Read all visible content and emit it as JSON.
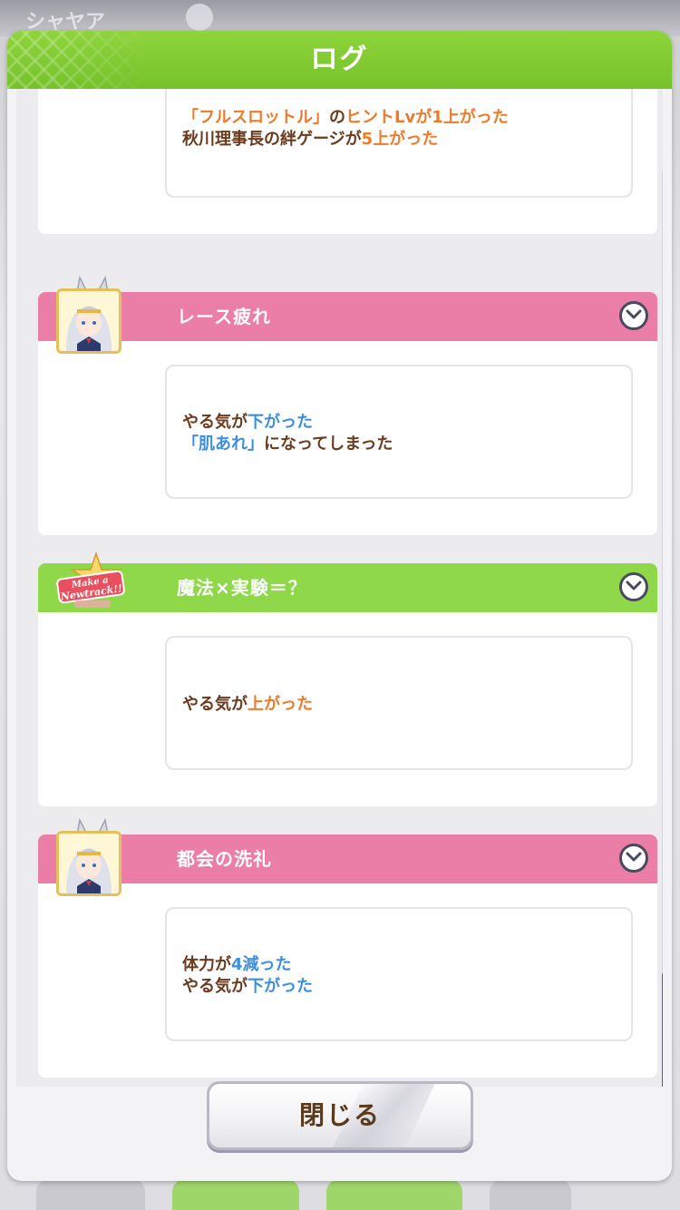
{
  "background": {
    "top_text": "シャヤア"
  },
  "modal": {
    "title": "ログ",
    "close_label": "閉じる"
  },
  "entries": [
    {
      "title": "",
      "lines": [
        [
          {
            "text": "「フルスロットル」",
            "tone": "orange"
          },
          {
            "text": "の",
            "tone": "brown"
          },
          {
            "text": "ヒントLvが1上がった",
            "tone": "orange"
          }
        ],
        [
          {
            "text": "秋川理事長の絆ゲージが",
            "tone": "brown"
          },
          {
            "text": "5上がった",
            "tone": "orange"
          }
        ]
      ]
    },
    {
      "title": "レース疲れ",
      "header_color": "#ea7ea6",
      "icon": "character-portrait",
      "lines": [
        [
          {
            "text": "やる気が",
            "tone": "brown"
          },
          {
            "text": "下がった",
            "tone": "blue"
          }
        ],
        [
          {
            "text": "「肌あれ」",
            "tone": "blue"
          },
          {
            "text": "になってしまった",
            "tone": "brown"
          }
        ]
      ]
    },
    {
      "title": "魔法×実験＝？",
      "header_color": "#8ed84a",
      "icon": "make-a-new-track-badge",
      "badge_text": [
        "Make a",
        "Newtrack!!"
      ],
      "lines": [
        [
          {
            "text": "やる気が",
            "tone": "brown"
          },
          {
            "text": "上がった",
            "tone": "orange"
          }
        ]
      ]
    },
    {
      "title": "都会の洗礼",
      "header_color": "#ea7ea6",
      "icon": "character-portrait",
      "lines": [
        [
          {
            "text": "体力が",
            "tone": "brown"
          },
          {
            "text": "4減った",
            "tone": "blue"
          }
        ],
        [
          {
            "text": "やる気が",
            "tone": "brown"
          },
          {
            "text": "下がった",
            "tone": "blue"
          }
        ]
      ]
    }
  ],
  "colors": {
    "header_green": "#7ccb2f",
    "text_brown": "#6b3b1f",
    "text_orange": "#ee7a2a",
    "text_blue": "#3e8ee0"
  }
}
